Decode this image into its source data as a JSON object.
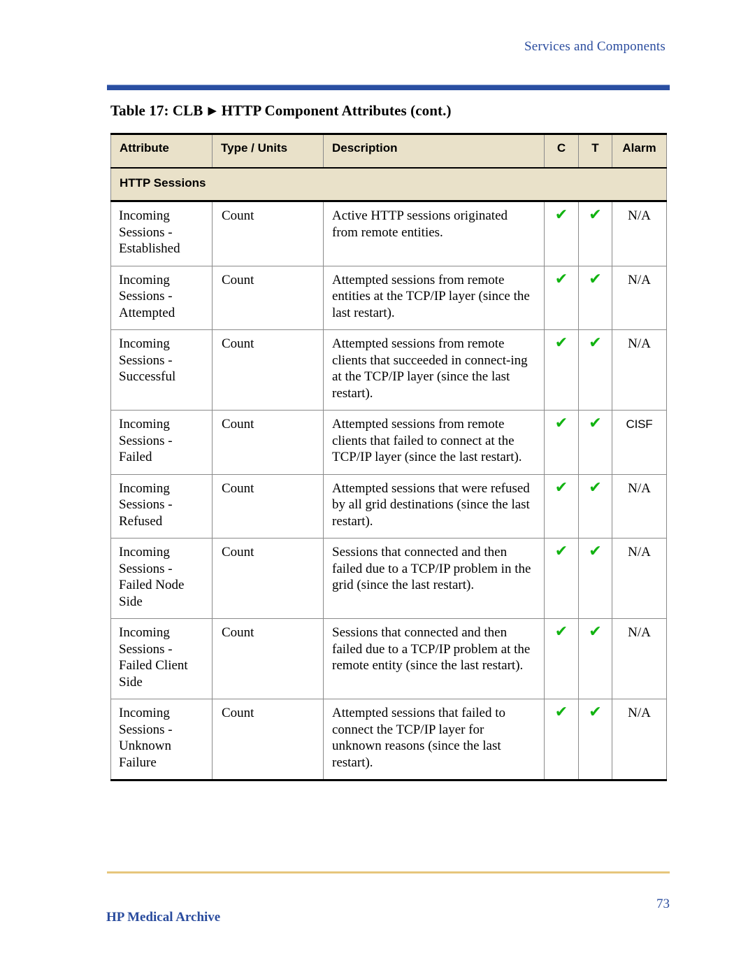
{
  "page": {
    "running_head": "Services and Components",
    "page_number": "73",
    "footer_text": "HP Medical Archive",
    "accent_blue": "#2a4c9e",
    "rule_blue": "#2a4fa2",
    "rule_gold": "#e6c67c",
    "header_fill": "#e9e1c9",
    "check_green": "#12b312"
  },
  "table": {
    "caption_prefix": "Table 17: CLB",
    "caption_arrow": "▶",
    "caption_suffix": "HTTP Component Attributes (cont.)",
    "columns": [
      {
        "key": "attribute",
        "label": "Attribute"
      },
      {
        "key": "type_units",
        "label": "Type / Units"
      },
      {
        "key": "description",
        "label": "Description"
      },
      {
        "key": "c",
        "label": "C"
      },
      {
        "key": "t",
        "label": "T"
      },
      {
        "key": "alarm",
        "label": "Alarm"
      }
    ],
    "section_label": "HTTP Sessions",
    "check_glyph": "✔",
    "rows": [
      {
        "attribute": "Incoming Sessions - Established",
        "type_units": "Count",
        "description": "Active HTTP sessions originated from remote entities.",
        "c": true,
        "t": true,
        "alarm": "N/A"
      },
      {
        "attribute": "Incoming Sessions - Attempted",
        "type_units": "Count",
        "description": "Attempted sessions from remote entities at the TCP/IP layer (since the last restart).",
        "c": true,
        "t": true,
        "alarm": "N/A"
      },
      {
        "attribute": "Incoming Sessions - Successful",
        "type_units": "Count",
        "description": "Attempted sessions from remote clients that succeeded in connect-ing at the TCP/IP layer (since the last restart).",
        "c": true,
        "t": true,
        "alarm": "N/A"
      },
      {
        "attribute": "Incoming Sessions - Failed",
        "type_units": "Count",
        "description": "Attempted sessions from remote clients that failed to connect at the TCP/IP layer (since the last restart).",
        "c": true,
        "t": true,
        "alarm": "CISF"
      },
      {
        "attribute": "Incoming Sessions - Refused",
        "type_units": "Count",
        "description": "Attempted sessions that were refused by all grid destinations (since the last restart).",
        "c": true,
        "t": true,
        "alarm": "N/A"
      },
      {
        "attribute": "Incoming Sessions - Failed Node Side",
        "type_units": "Count",
        "description": "Sessions that connected and then failed due to a TCP/IP problem in the grid (since the last restart).",
        "c": true,
        "t": true,
        "alarm": "N/A"
      },
      {
        "attribute": "Incoming Sessions - Failed Client Side",
        "type_units": "Count",
        "description": "Sessions that connected and then failed due to a TCP/IP problem at the remote entity (since the last restart).",
        "c": true,
        "t": true,
        "alarm": "N/A"
      },
      {
        "attribute": "Incoming Sessions - Unknown Failure",
        "type_units": "Count",
        "description": "Attempted sessions that failed to connect the TCP/IP layer for unknown reasons (since the last restart).",
        "c": true,
        "t": true,
        "alarm": "N/A"
      }
    ]
  }
}
